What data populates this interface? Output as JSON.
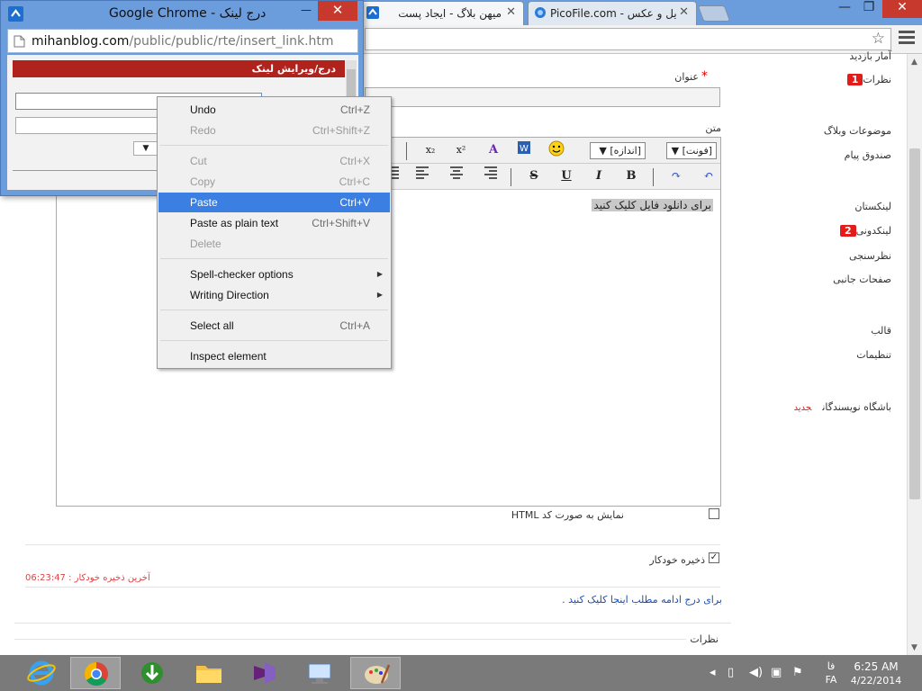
{
  "browser": {
    "tabs": [
      {
        "title": "میهن بلاگ - ایجاد پست",
        "active": true
      },
      {
        "title": "PicoFile.com - آپلود فایل و عکس",
        "active": false
      }
    ],
    "window_controls": {
      "minimize": "—",
      "maximize": "❐",
      "close": "✕"
    },
    "menu_icon": "hamburger-icon",
    "bookmark_icon": "star-icon"
  },
  "popup": {
    "title": "درج لینک - Google Chrome",
    "url_host": "mihanblog.com",
    "url_path": "/public/public/rte/insert_link.htm",
    "header": "درج/ویرایش لینک",
    "close": "✕",
    "minimize": "—"
  },
  "context_menu": {
    "items": [
      {
        "label": "Undo",
        "shortcut": "Ctrl+Z",
        "disabled": false,
        "highlighted": false
      },
      {
        "label": "Redo",
        "shortcut": "Ctrl+Shift+Z",
        "disabled": true,
        "highlighted": false
      },
      {
        "label": "Cut",
        "shortcut": "Ctrl+X",
        "disabled": true,
        "highlighted": false
      },
      {
        "label": "Copy",
        "shortcut": "Ctrl+C",
        "disabled": true,
        "highlighted": false
      },
      {
        "label": "Paste",
        "shortcut": "Ctrl+V",
        "disabled": false,
        "highlighted": true
      },
      {
        "label": "Paste as plain text",
        "shortcut": "Ctrl+Shift+V",
        "disabled": false,
        "highlighted": false
      },
      {
        "label": "Delete",
        "shortcut": "",
        "disabled": true,
        "highlighted": false
      },
      {
        "label": "Spell-checker options",
        "shortcut": "",
        "disabled": false,
        "highlighted": false,
        "submenu": true
      },
      {
        "label": "Writing Direction",
        "shortcut": "",
        "disabled": false,
        "highlighted": false,
        "submenu": true
      },
      {
        "label": "Select all",
        "shortcut": "Ctrl+A",
        "disabled": false,
        "highlighted": false
      },
      {
        "label": "Inspect element",
        "shortcut": "",
        "disabled": false,
        "highlighted": false
      }
    ]
  },
  "form": {
    "title_label": "عنوان",
    "text_label": "متن",
    "font_select": "[فونت]",
    "size_select": "[اندازه]",
    "editor_content": "برای دانلود فایل کلیک کنید",
    "html_checkbox_label": "نمایش به صورت کد HTML",
    "autosave_label": "ذخیره خودکار",
    "autosave_checked": true,
    "last_autosave": "آخرین ذخیره خودکار : 06:23:47",
    "continue_link": "برای درج ادامه مطلب اینجا کلیک کنید .",
    "comments_section": "نظرات"
  },
  "sidebar": {
    "items": [
      {
        "label": "آمار بازدید"
      },
      {
        "label": "نظرات",
        "badge": "1"
      },
      {
        "label": "موضوعات وبلاگ"
      },
      {
        "label": "صندوق پیام"
      },
      {
        "label": "لینکستان"
      },
      {
        "label": "لینکدونی",
        "badge": "2"
      },
      {
        "label": "نظرسنجی"
      },
      {
        "label": "صفحات جانبی"
      },
      {
        "label": "قالب"
      },
      {
        "label": "تنظیمات"
      },
      {
        "label": "باشگاه نویسندگان",
        "tag": "جدید"
      }
    ]
  },
  "taskbar": {
    "apps": [
      "internet-explorer",
      "chrome",
      "internet-download-manager",
      "file-explorer",
      "visual-studio",
      "control-panel",
      "paint"
    ],
    "language": "FA",
    "language_short": "فا",
    "time": "6:25 AM",
    "date": "4/22/2014"
  }
}
